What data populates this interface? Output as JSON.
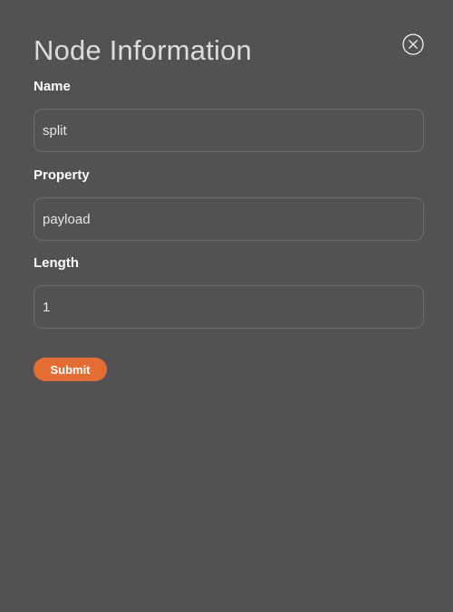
{
  "dialog": {
    "title": "Node Information",
    "close_icon": "close-icon"
  },
  "fields": [
    {
      "label": "Name",
      "value": "split"
    },
    {
      "label": "Property",
      "value": "payload"
    },
    {
      "label": "Length",
      "value": "1"
    }
  ],
  "actions": {
    "submit_label": "Submit"
  },
  "colors": {
    "background": "#535152",
    "accent": "#e46d36",
    "input_border": "#6e6c6d"
  }
}
